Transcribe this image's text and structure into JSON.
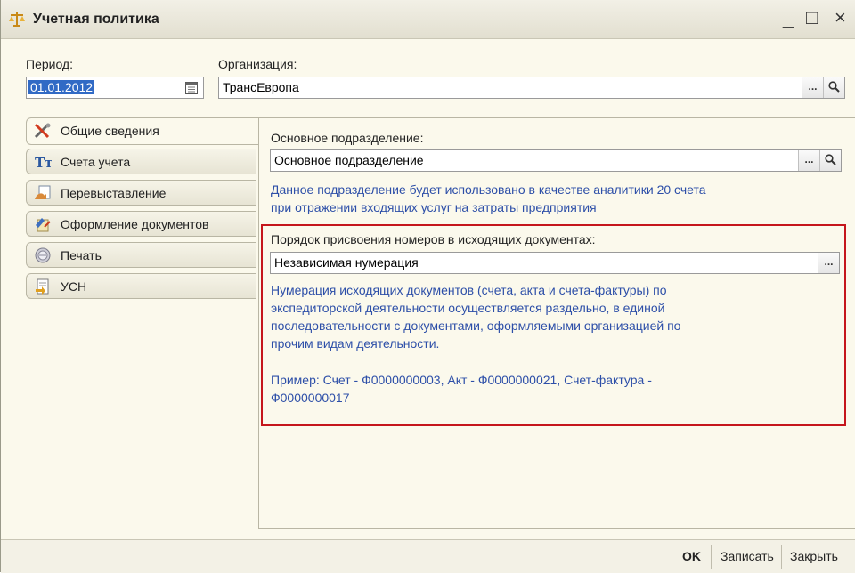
{
  "window": {
    "title": "Учетная политика",
    "controls": {
      "minimize": "_",
      "maximize": "□",
      "close": "×"
    }
  },
  "header": {
    "period_label": "Период:",
    "period_value": "01.01.2012",
    "org_label": "Организация:",
    "org_value": "ТрансЕвропа",
    "dots": "..."
  },
  "tabs": [
    {
      "label": "Общие сведения",
      "icon": "tools-icon"
    },
    {
      "label": "Счета учета",
      "icon": "accounts-icon"
    },
    {
      "label": "Перевыставление",
      "icon": "reinvoice-icon"
    },
    {
      "label": "Оформление документов",
      "icon": "documents-icon"
    },
    {
      "label": "Печать",
      "icon": "print-icon"
    },
    {
      "label": "УСН",
      "icon": "usn-icon"
    }
  ],
  "main": {
    "division_label": "Основное подразделение:",
    "division_value": "Основное подразделение",
    "division_hint_1": "Данное подразделение будет использовано в качестве аналитики 20 счета",
    "division_hint_2": "при отражении входящих услуг на затраты предприятия",
    "numbering_label": "Порядок присвоения номеров в исходящих документах:",
    "numbering_value": "Независимая нумерация",
    "numbering_hint_1": "Нумерация исходящих документов (счета, акта и счета-фактуры) по",
    "numbering_hint_2": "экспедиторской деятельности осуществляется раздельно, в единой",
    "numbering_hint_3": "последовательности с документами, оформляемыми организацией по",
    "numbering_hint_4": "прочим видам деятельности.",
    "example_1": "Пример: Счет - Ф0000000003, Акт - Ф0000000021, Счет-фактура -",
    "example_2": "Ф0000000017"
  },
  "footer": {
    "ok": "OK",
    "save": "Записать",
    "close": "Закрыть"
  },
  "colors": {
    "hint": "#2d4fa8",
    "highlight": "#c5161c",
    "window_bg": "#fbf9ec"
  }
}
